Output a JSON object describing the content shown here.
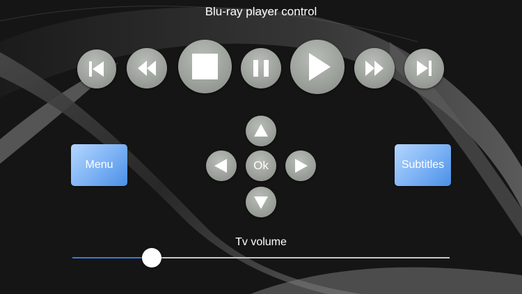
{
  "title": "Blu-ray player control",
  "transport": [
    {
      "name": "skip-previous-button",
      "icon": "skip-previous-icon"
    },
    {
      "name": "rewind-button",
      "icon": "rewind-icon"
    },
    {
      "name": "stop-button",
      "icon": "stop-icon"
    },
    {
      "name": "pause-button",
      "icon": "pause-icon"
    },
    {
      "name": "play-button",
      "icon": "play-icon"
    },
    {
      "name": "fast-forward-button",
      "icon": "fast-forward-icon"
    },
    {
      "name": "skip-next-button",
      "icon": "skip-next-icon"
    }
  ],
  "dpad": {
    "ok_label": "Ok",
    "up_icon": "arrow-up-icon",
    "down_icon": "arrow-down-icon",
    "left_icon": "arrow-left-icon",
    "right_icon": "arrow-right-icon"
  },
  "menu_label": "Menu",
  "subtitles_label": "Subtitles",
  "volume": {
    "label": "Tv volume",
    "value": 0.21
  },
  "colors": {
    "accent": "#2f7de0",
    "button_gray": "#9ea29c",
    "button_blue": "#7bb1f4"
  }
}
